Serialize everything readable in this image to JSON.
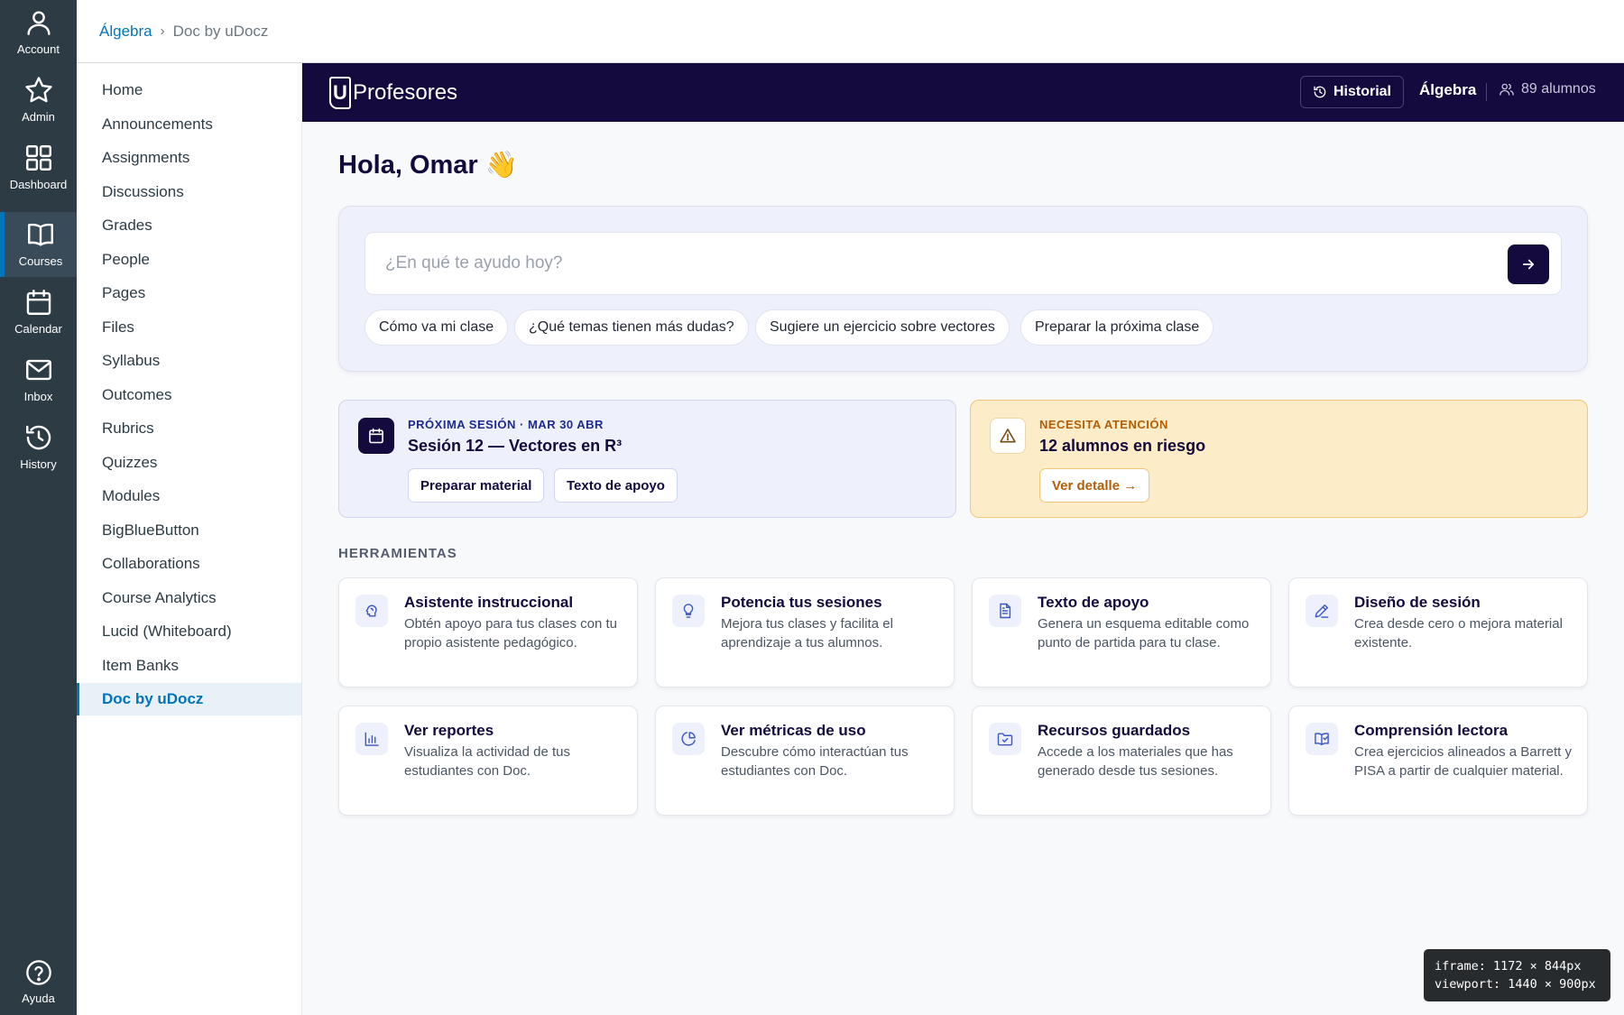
{
  "global_nav": {
    "items": [
      {
        "label": "Account",
        "icon": "user-icon"
      },
      {
        "label": "Admin",
        "icon": "star-icon"
      },
      {
        "label": "Dashboard",
        "icon": "grid-icon"
      },
      {
        "label": "Courses",
        "icon": "book-icon",
        "active": true
      },
      {
        "label": "Calendar",
        "icon": "calendar-icon"
      },
      {
        "label": "Inbox",
        "icon": "mail-icon"
      },
      {
        "label": "History",
        "icon": "history-icon"
      }
    ],
    "help_label": "Ayuda"
  },
  "breadcrumb": {
    "course": "Álgebra",
    "separator": "›",
    "current": "Doc by uDocz"
  },
  "course_nav": {
    "items": [
      "Home",
      "Announcements",
      "Assignments",
      "Discussions",
      "Grades",
      "People",
      "Pages",
      "Files",
      "Syllabus",
      "Outcomes",
      "Rubrics",
      "Quizzes",
      "Modules",
      "BigBlueButton",
      "Collaborations",
      "Course Analytics",
      "Lucid (Whiteboard)",
      "Item Banks",
      "Doc by uDocz"
    ],
    "active": "Doc by uDocz"
  },
  "app": {
    "brand_mark": "U",
    "brand_name": "Profesores",
    "history_button": "Historial",
    "course_name": "Álgebra",
    "students": "89 alumnos",
    "greeting": "Hola, Omar 👋",
    "ask": {
      "placeholder": "¿En qué te ayudo hoy?",
      "chips": [
        "Cómo va mi clase",
        "¿Qué temas tienen más dudas?",
        "Sugiere un ejercicio sobre vectores",
        "Preparar la próxima clase"
      ]
    },
    "session_card": {
      "kicker": "PRÓXIMA SESIÓN · MAR 30 ABR",
      "title": "Sesión 12 — Vectores en R³",
      "actions": [
        "Preparar material",
        "Texto de apoyo"
      ]
    },
    "alert_card": {
      "kicker": "NECESITA ATENCIÓN",
      "title": "12 alumnos en riesgo",
      "action": "Ver detalle →"
    },
    "tools_heading": "HERRAMIENTAS",
    "tools": [
      {
        "title": "Asistente instruccional",
        "desc": "Obtén apoyo para tus clases con tu propio asistente pedagógico.",
        "icon": "brain-icon"
      },
      {
        "title": "Potencia tus sesiones",
        "desc": "Mejora tus clases y facilita el aprendizaje a tus alumnos.",
        "icon": "lightbulb-icon"
      },
      {
        "title": "Texto de apoyo",
        "desc": "Genera un esquema editable como punto de partida para tu clase.",
        "icon": "document-icon"
      },
      {
        "title": "Diseño de sesión",
        "desc": "Crea desde cero o mejora material existente.",
        "icon": "pencil-icon"
      },
      {
        "title": "Ver reportes",
        "desc": "Visualiza la actividad de tus estudiantes con Doc.",
        "icon": "bar-chart-icon"
      },
      {
        "title": "Ver métricas de uso",
        "desc": "Descubre cómo interactúan tus estudiantes con Doc.",
        "icon": "pie-chart-icon"
      },
      {
        "title": "Recursos guardados",
        "desc": "Accede a los materiales que has generado desde tus sesiones.",
        "icon": "folder-check-icon"
      },
      {
        "title": "Comprensión lectora",
        "desc": "Crea ejercicios alineados a Barrett y PISA a partir de cualquier material.",
        "icon": "book-check-icon"
      }
    ]
  },
  "dev_badge": {
    "iframe": "iframe: 1172 × 844px",
    "viewport": "viewport: 1440 × 900px"
  },
  "colors": {
    "nav_bg": "#2d3b45",
    "brand_dark": "#150a3d",
    "link_blue": "#0374b5",
    "alert_bg": "#fdecc8",
    "alert_text": "#b35e07"
  }
}
